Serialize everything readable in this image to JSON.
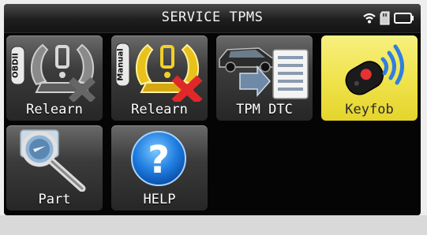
{
  "header": {
    "title": "SERVICE TPMS",
    "status_icons": [
      "wifi-icon",
      "sd-card-icon",
      "battery-icon"
    ]
  },
  "menu": {
    "items": [
      {
        "label": "Relearn",
        "badge": "OBDII",
        "icon": "tire-obd-icon",
        "selected": false
      },
      {
        "label": "Relearn",
        "badge": "Manual",
        "icon": "tire-manual-icon",
        "selected": false
      },
      {
        "label": "TPM DTC",
        "icon": "car-dtc-icon",
        "selected": false
      },
      {
        "label": "Keyfob",
        "icon": "keyfob-icon",
        "selected": true
      },
      {
        "label": "Part",
        "icon": "magnifier-icon",
        "selected": false
      },
      {
        "label": "HELP",
        "icon": "help-icon",
        "selected": false
      }
    ]
  },
  "colors": {
    "selected_tile": "#efe24a",
    "tile": "#3c3c3c",
    "screen_background": "#050505"
  }
}
